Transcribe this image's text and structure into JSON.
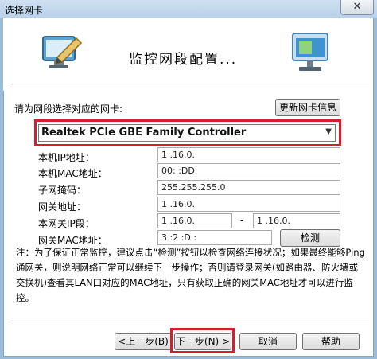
{
  "window": {
    "title": "选择网卡",
    "close_glyph": "✕"
  },
  "banner": {
    "title": "监控网段配置...",
    "left_icon": "monitor-pencil-icon",
    "right_icon": "network-window-icon"
  },
  "adapter": {
    "prompt": "请为网段选择对应的网卡:",
    "update_button": "更新网卡信息",
    "selected": "Realtek PCIe GBE Family Controller"
  },
  "fields": {
    "ip_label": "本机IP地址：",
    "ip_value": "1 .16.0.",
    "mac_label": "本机MAC地址：",
    "mac_value": "00:    :DD",
    "mask_label": "子网掩码：",
    "mask_value": "255.255.255.0",
    "gateway_label": "网关地址：",
    "gateway_value": "1 .16.0.",
    "segment_label": "本网关IP段：",
    "segment_start": "1 .16.0.",
    "segment_dash": "-",
    "segment_end": "1 .16.0.",
    "gw_mac_label": "网关MAC地址：",
    "gw_mac_value": "3 :2 :D :",
    "detect_button": "检测"
  },
  "note": "注：为了保证正常监控，建议点击“检测”按钮以检查网络连接状况；如果最终能够Ping通网关，则说明网络正常可以继续下一步操作；否则请登录网关(如路由器、防火墙或交换机)查看其LAN口对应的MAC地址，只有获取正确的网关MAC地址才可以进行监控。",
  "buttons": {
    "back": "<上一步(B)",
    "next": "下一步(N) >",
    "cancel": "取消",
    "help": "帮助"
  },
  "colors": {
    "highlight": "#d4202c",
    "frame": "#9cbbd6"
  }
}
